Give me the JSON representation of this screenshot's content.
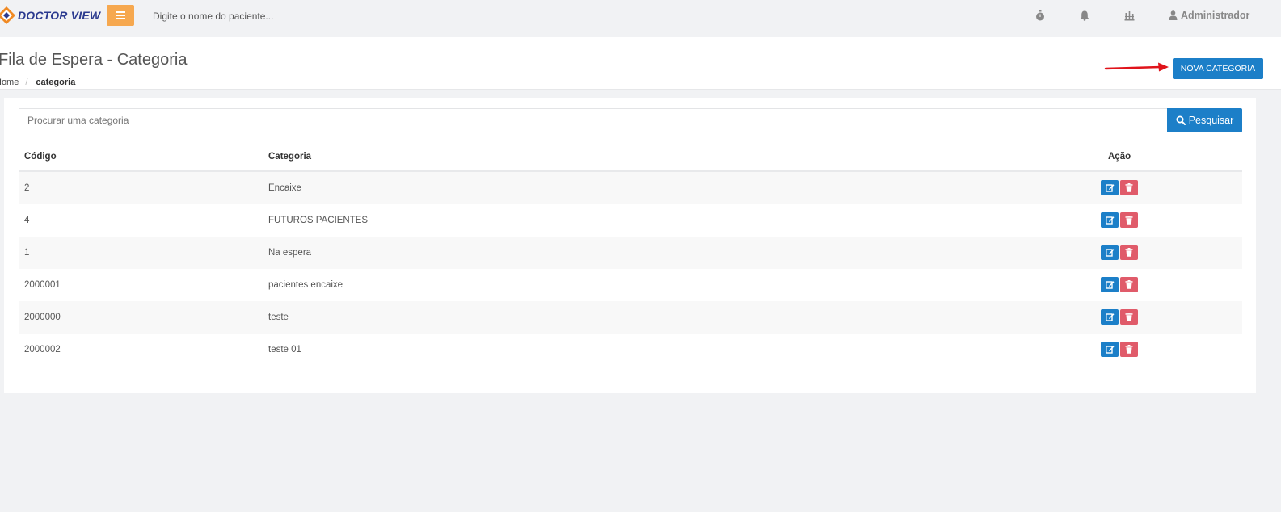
{
  "app": {
    "logo_text": "DOCTOR VIEW",
    "patient_search_placeholder": "Digite o nome do paciente...",
    "user_name": "Administrador"
  },
  "page": {
    "title": "Fila de Espera - Categoria",
    "breadcrumb": {
      "home": "Home",
      "separator": "/",
      "current": "categoria"
    },
    "new_button": "NOVA CATEGORIA"
  },
  "search": {
    "placeholder": "Procurar uma categoria",
    "button": "Pesquisar"
  },
  "table": {
    "columns": {
      "code": "Código",
      "category": "Categoria",
      "action": "Ação"
    },
    "rows": [
      {
        "code": "2",
        "category": "Encaixe"
      },
      {
        "code": "4",
        "category": "FUTUROS PACIENTES"
      },
      {
        "code": "1",
        "category": "Na espera"
      },
      {
        "code": "2000001",
        "category": "pacientes encaixe"
      },
      {
        "code": "2000000",
        "category": "teste"
      },
      {
        "code": "2000002",
        "category": "teste 01"
      }
    ]
  },
  "colors": {
    "primary": "#1c7fc8",
    "menu_button": "#f6a84f",
    "danger": "#e05b6a",
    "annotation_arrow": "#e0141b"
  },
  "icons": [
    "stopwatch-icon",
    "bell-icon",
    "network-icon",
    "user-icon",
    "search-icon",
    "edit-icon",
    "trash-icon",
    "hamburger-icon"
  ]
}
